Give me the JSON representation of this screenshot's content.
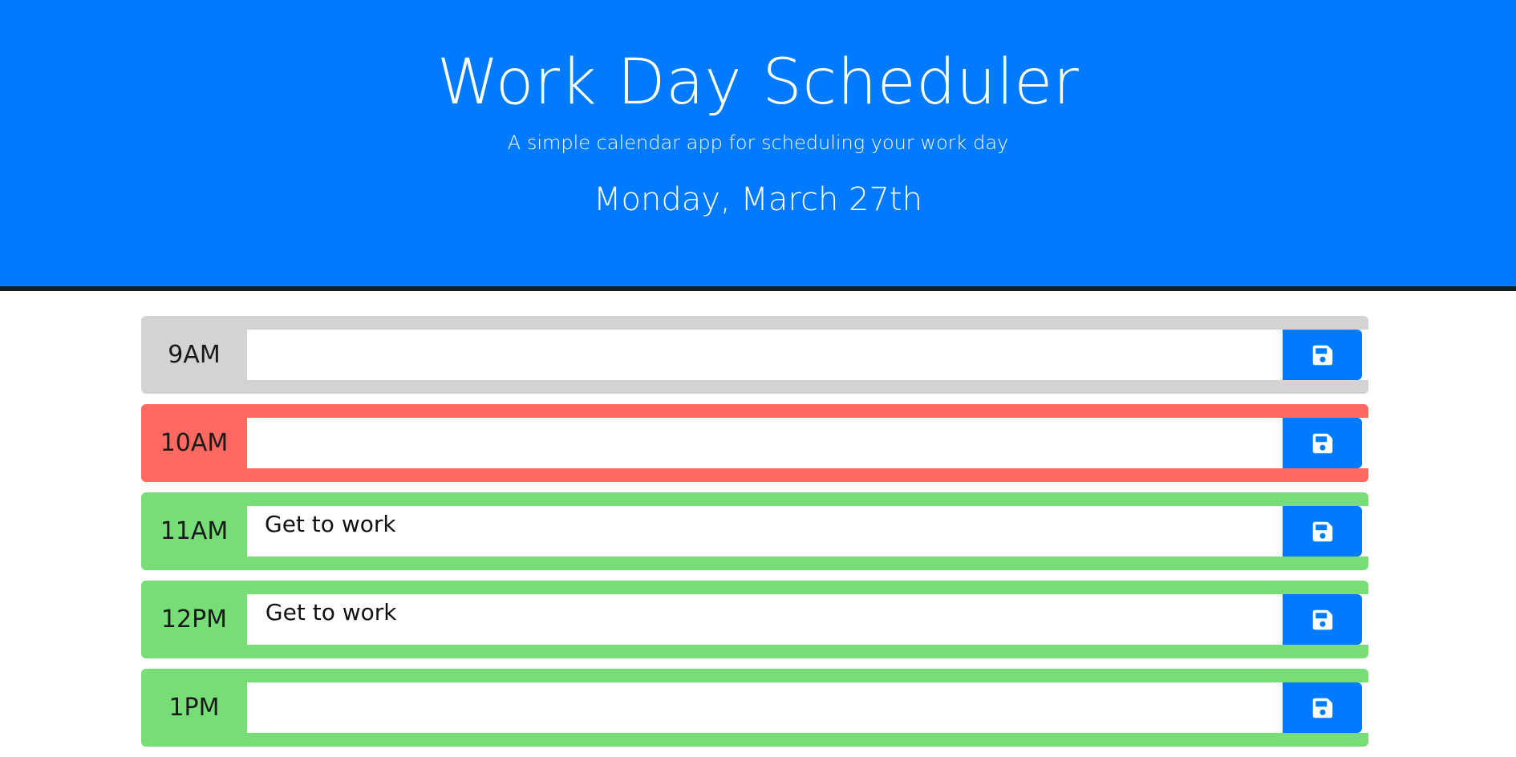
{
  "header": {
    "title": "Work Day Scheduler",
    "subtitle": "A simple calendar app for scheduling your work day",
    "current_date": "Monday, March 27th"
  },
  "colors": {
    "header_bg": "#007bff",
    "past": "#d3d3d3",
    "present": "#ff6961",
    "future": "#77dd77",
    "save_button": "#007bff"
  },
  "rows": [
    {
      "hour": "9AM",
      "status": "past",
      "text": ""
    },
    {
      "hour": "10AM",
      "status": "present",
      "text": ""
    },
    {
      "hour": "11AM",
      "status": "future",
      "text": "Get to work"
    },
    {
      "hour": "12PM",
      "status": "future",
      "text": " Get to work"
    },
    {
      "hour": "1PM",
      "status": "future",
      "text": ""
    }
  ],
  "icons": {
    "save": "floppy-disk-icon"
  }
}
